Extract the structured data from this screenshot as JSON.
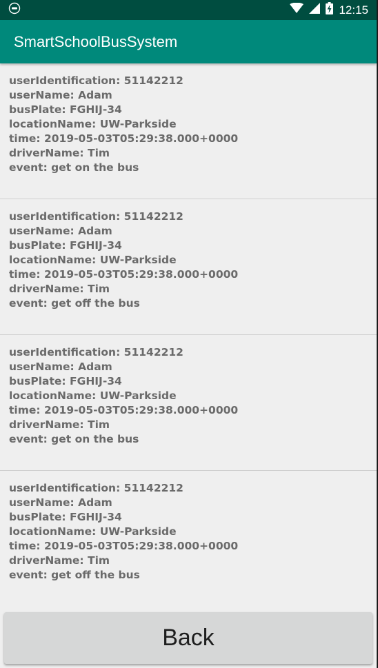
{
  "status_bar": {
    "time": "12:15",
    "icons": [
      "notification-icon",
      "wifi-icon",
      "cellular-signal-icon",
      "battery-charging-icon"
    ]
  },
  "app_bar": {
    "title": "SmartSchoolBusSystem"
  },
  "records": [
    {
      "userIdentification": "userIdentification: 51142212",
      "userName": "userName: Adam",
      "busPlate": "busPlate: FGHIJ-34",
      "locationName": "locationName: UW-Parkside",
      "time": "time: 2019-05-03T05:29:38.000+0000",
      "driverName": "driverName: Tim",
      "event": "event: get on the bus"
    },
    {
      "userIdentification": "userIdentification: 51142212",
      "userName": "userName: Adam",
      "busPlate": "busPlate: FGHIJ-34",
      "locationName": "locationName: UW-Parkside",
      "time": "time: 2019-05-03T05:29:38.000+0000",
      "driverName": "driverName: Tim",
      "event": "event: get off the bus"
    },
    {
      "userIdentification": "userIdentification: 51142212",
      "userName": "userName: Adam",
      "busPlate": "busPlate: FGHIJ-34",
      "locationName": "locationName: UW-Parkside",
      "time": "time: 2019-05-03T05:29:38.000+0000",
      "driverName": "driverName: Tim",
      "event": "event: get on the bus"
    },
    {
      "userIdentification": "userIdentification: 51142212",
      "userName": "userName: Adam",
      "busPlate": "busPlate: FGHIJ-34",
      "locationName": "locationName: UW-Parkside",
      "time": "time: 2019-05-03T05:29:38.000+0000",
      "driverName": "driverName: Tim",
      "event": "event: get off the bus"
    }
  ],
  "footer": {
    "back_label": "Back"
  },
  "colors": {
    "status_bar": "#004d40",
    "app_bar": "#00897b",
    "background": "#efefef",
    "record_text": "#6a6a6a",
    "button": "#d6d7d7"
  }
}
